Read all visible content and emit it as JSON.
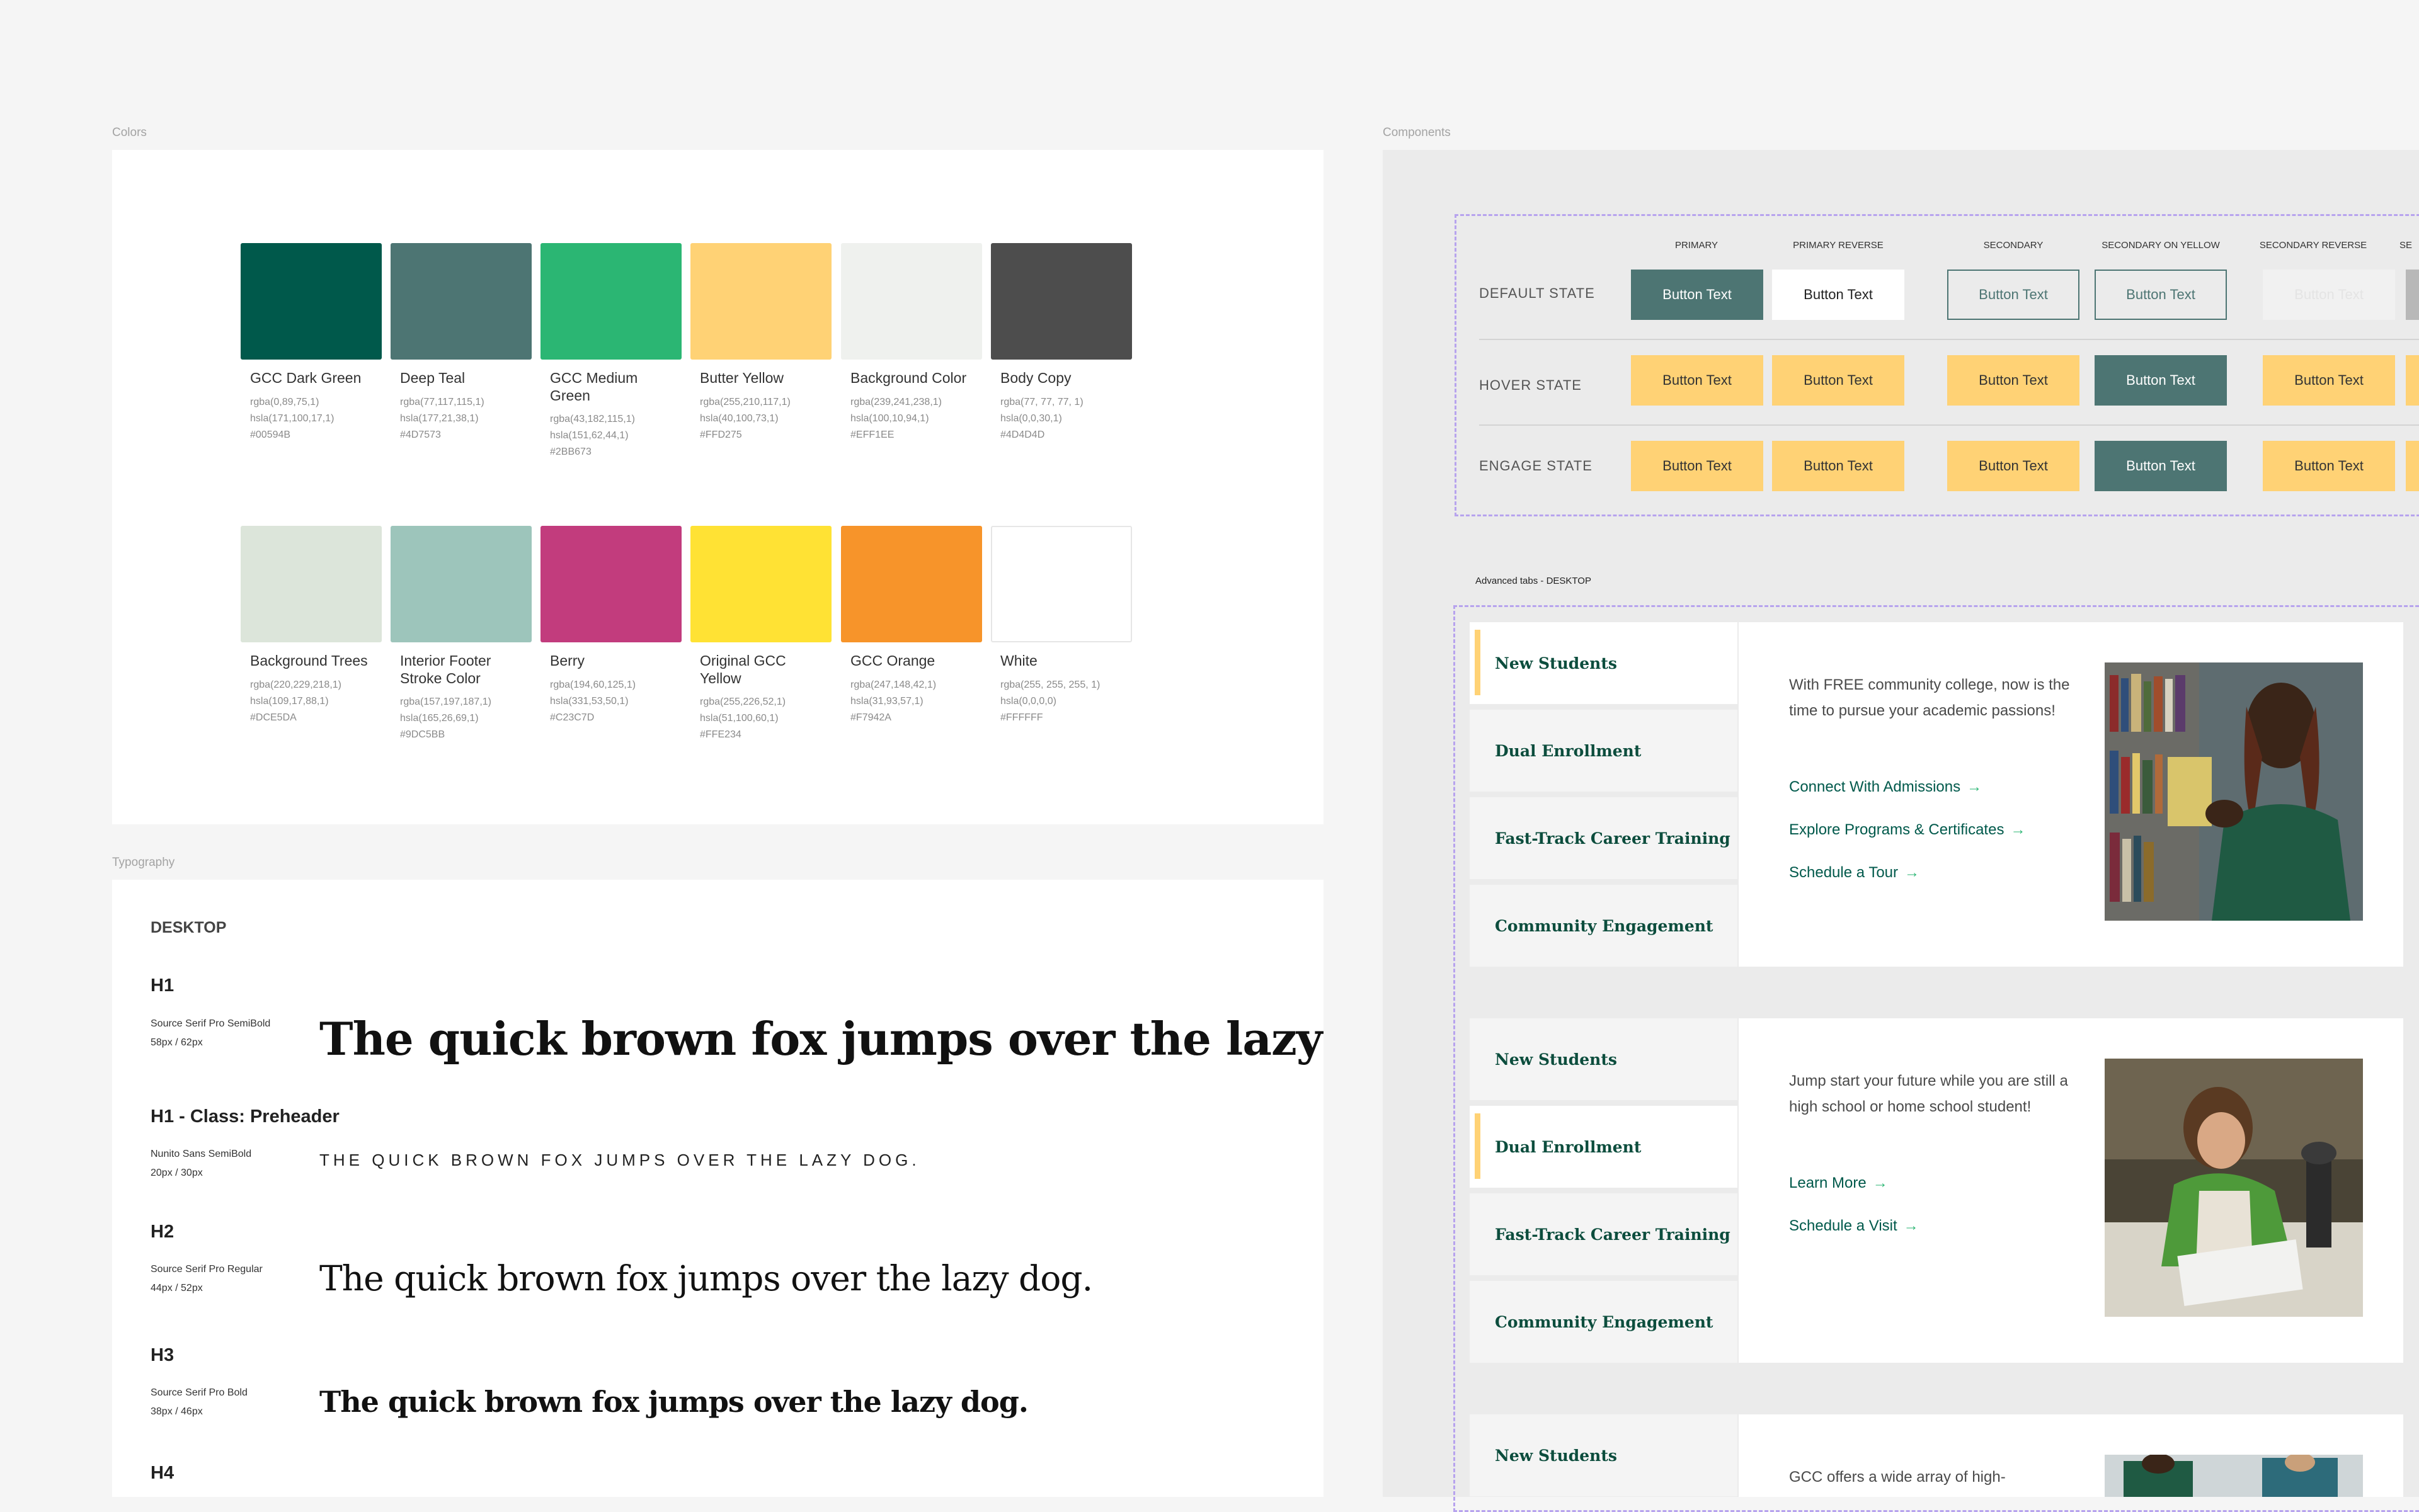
{
  "colors": {
    "label": "Colors",
    "swatches": [
      {
        "name": "GCC Dark Green",
        "hex_color": "#00594B",
        "values": [
          "rgba(0,89,75,1)",
          "hsla(171,100,17,1)",
          "#00594B"
        ]
      },
      {
        "name": "Deep Teal",
        "hex_color": "#4D7573",
        "values": [
          "rgba(77,117,115,1)",
          "hsla(177,21,38,1)",
          "#4D7573"
        ]
      },
      {
        "name": "GCC Medium Green",
        "hex_color": "#2BB673",
        "values": [
          "rgba(43,182,115,1)",
          "hsla(151,62,44,1)",
          "#2BB673"
        ]
      },
      {
        "name": "Butter Yellow",
        "hex_color": "#FFD275",
        "values": [
          "rgba(255,210,117,1)",
          "hsla(40,100,73,1)",
          "#FFD275"
        ]
      },
      {
        "name": "Background Color",
        "hex_color": "#EFF1EE",
        "values": [
          "rgba(239,241,238,1)",
          "hsla(100,10,94,1)",
          "#EFF1EE"
        ]
      },
      {
        "name": "Body Copy",
        "hex_color": "#4D4D4D",
        "values": [
          "rgba(77, 77, 77, 1)",
          "hsla(0,0,30,1)",
          "#4D4D4D"
        ]
      },
      {
        "name": "Background Trees",
        "hex_color": "#DCE5DA",
        "values": [
          "rgba(220,229,218,1)",
          "hsla(109,17,88,1)",
          "#DCE5DA"
        ]
      },
      {
        "name": "Interior Footer Stroke Color",
        "hex_color": "#9DC5BB",
        "values": [
          "rgba(157,197,187,1)",
          "hsla(165,26,69,1)",
          "#9DC5BB"
        ]
      },
      {
        "name": "Berry",
        "hex_color": "#C23C7D",
        "values": [
          "rgba(194,60,125,1)",
          "hsla(331,53,50,1)",
          "#C23C7D"
        ]
      },
      {
        "name": "Original GCC Yellow",
        "hex_color": "#FFE234",
        "values": [
          "rgba(255,226,52,1)",
          "hsla(51,100,60,1)",
          "#FFE234"
        ]
      },
      {
        "name": "GCC Orange",
        "hex_color": "#F7942A",
        "values": [
          "rgba(247,148,42,1)",
          "hsla(31,93,57,1)",
          "#F7942A"
        ]
      },
      {
        "name": "White",
        "hex_color": "#FFFFFF",
        "values": [
          "rgba(255, 255, 255, 1)",
          "hsla(0,0,0,0)",
          "#FFFFFF"
        ]
      }
    ]
  },
  "typography": {
    "label": "Typography",
    "breakpoint": "DESKTOP",
    "styles": [
      {
        "heading": "H1",
        "font": "Source Serif Pro SemiBold",
        "size": "58px / 62px",
        "sample": "The quick brown fox jumps over the lazy dog."
      },
      {
        "heading": "H1 - Class: Preheader",
        "font": "Nunito Sans SemiBold",
        "size": "20px / 30px",
        "sample": "THE QUICK BROWN FOX JUMPS OVER THE LAZY DOG."
      },
      {
        "heading": "H2",
        "font": "Source Serif Pro Regular",
        "size": "44px / 52px",
        "sample": "The quick brown fox jumps over the lazy dog."
      },
      {
        "heading": "H3",
        "font": "Source Serif Pro Bold",
        "size": "38px / 46px",
        "sample": "The quick brown fox jumps over the lazy dog."
      },
      {
        "heading": "H4"
      }
    ]
  },
  "components": {
    "label": "Components",
    "button_columns": [
      "PRIMARY",
      "PRIMARY REVERSE",
      "SECONDARY",
      "SECONDARY ON YELLOW",
      "SECONDARY REVERSE",
      "SE"
    ],
    "states": [
      "DEFAULT STATE",
      "HOVER STATE",
      "ENGAGE STATE"
    ],
    "button_text": "Button Text",
    "tabs_label": "Advanced tabs - DESKTOP",
    "tab_names": [
      "New Students",
      "Dual Enrollment",
      "Fast-Track Career Training",
      "Community Engagement"
    ],
    "panels": [
      {
        "text": "With FREE community college, now is the time to pursue your academic passions!",
        "links": [
          "Connect With Admissions",
          "Explore Programs & Certificates",
          "Schedule a Tour"
        ]
      },
      {
        "text": "Jump start your future while you are still a high school or home school student!",
        "links": [
          "Learn More",
          "Schedule a Visit"
        ]
      },
      {
        "text": "GCC offers a wide array of high-"
      }
    ],
    "arrow_glyph": "→"
  }
}
